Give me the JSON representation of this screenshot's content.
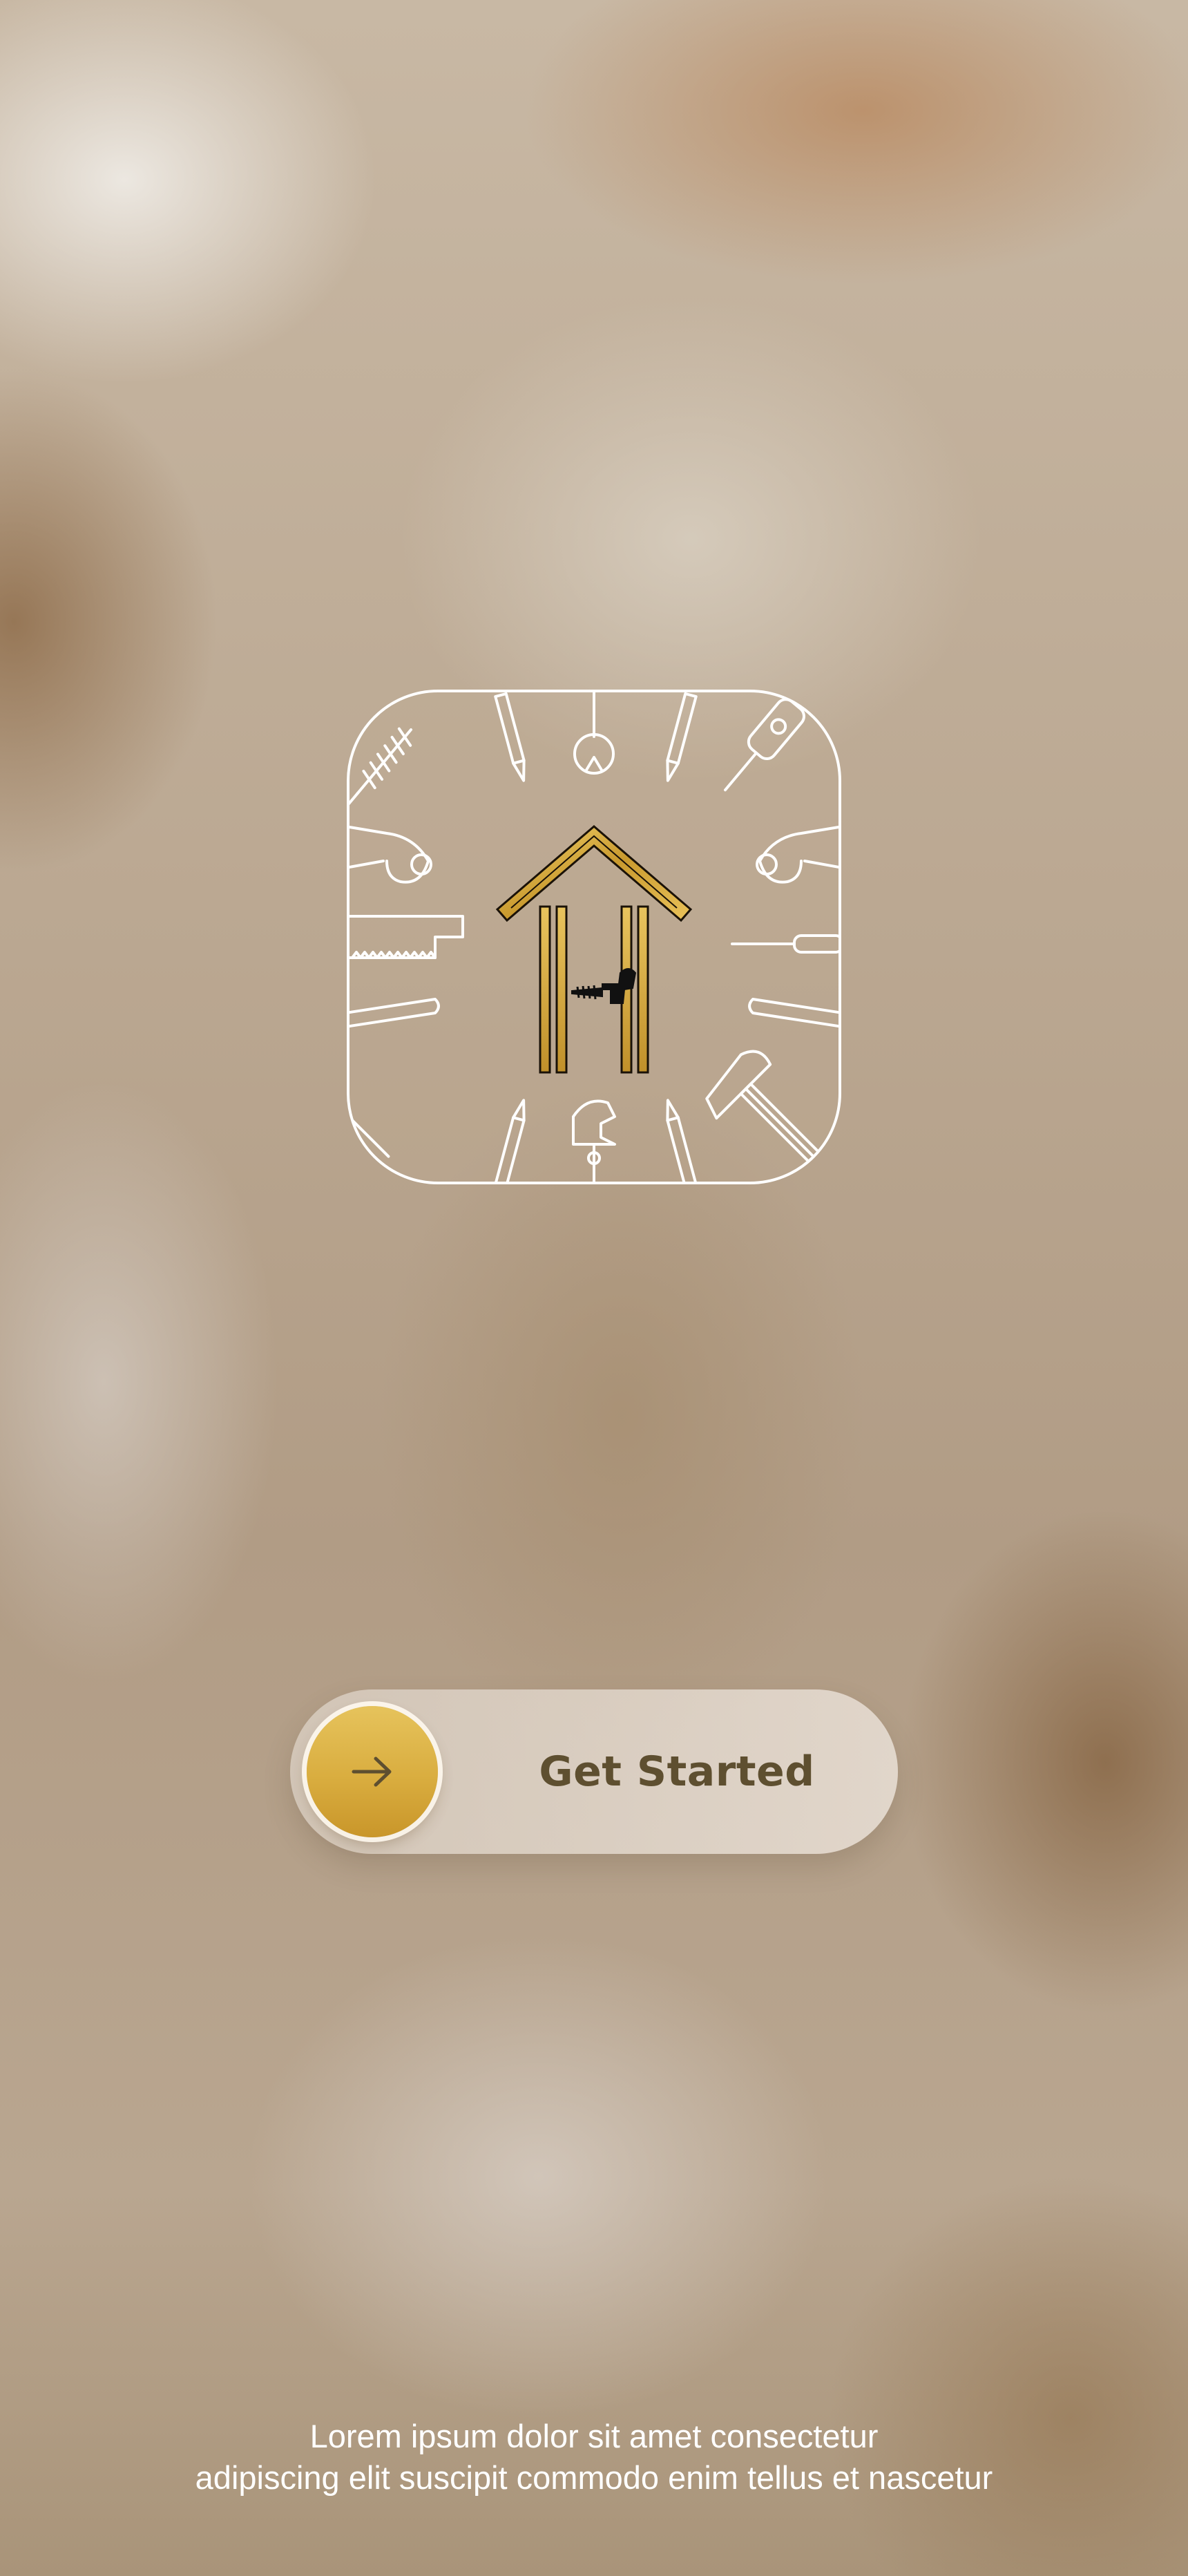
{
  "logo": {
    "icon": "home-repair-tools-logo-icon"
  },
  "cta": {
    "label": "Get Started",
    "icon": "arrow-right-icon"
  },
  "footer": {
    "line1": "Lorem ipsum dolor sit amet consectetur",
    "line2": "adipiscing elit suscipit commodo enim tellus et nascetur"
  },
  "colors": {
    "accent_gold": "#d9ad3f",
    "label_text": "#5e4f30",
    "footer_text": "#ffffff"
  }
}
